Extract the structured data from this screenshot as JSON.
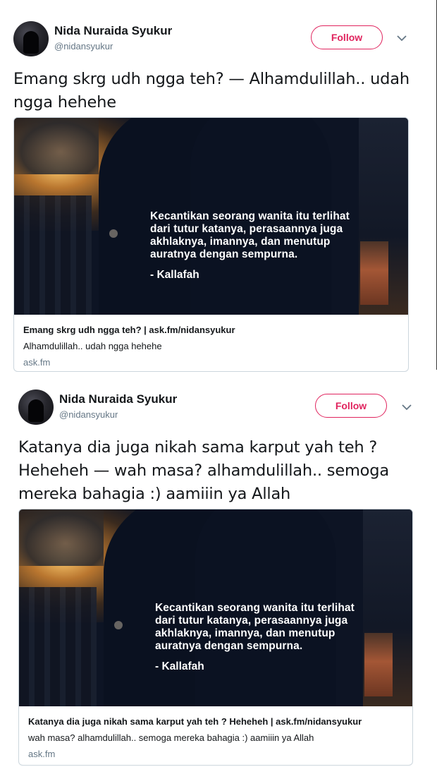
{
  "tweets": [
    {
      "author": {
        "name": "Nida Nuraida Syukur",
        "handle": "@nidansyukur"
      },
      "follow_label": "Follow",
      "text": "Emang skrg udh ngga teh? — Alhamdulillah.. udah ngga hehehe",
      "card": {
        "image_quote": "Kecantikan seorang wanita itu terlihat\ndari tutur katanya, perasaannya juga\nakhlaknya, imannya, dan menutup\nauratnya dengan sempurna.",
        "image_author": "- Kallafah",
        "title": "Emang skrg udh ngga teh? | ask.fm/nidansyukur",
        "description": "Alhamdulillah.. udah ngga hehehe",
        "domain": "ask.fm"
      }
    },
    {
      "author": {
        "name": "Nida Nuraida Syukur",
        "handle": "@nidansyukur"
      },
      "follow_label": "Follow",
      "text": "Katanya dia juga nikah sama karput yah teh ? Heheheh — wah masa? alhamdulillah.. semoga mereka bahagia :) aamiiin ya Allah",
      "card": {
        "image_quote": "Kecantikan seorang wanita itu terlihat\ndari tutur katanya, perasaannya juga\nakhlaknya, imannya, dan menutup\nauratnya dengan sempurna.",
        "image_author": "- Kallafah",
        "title": "Katanya dia juga nikah sama karput yah teh ? Heheheh | ask.fm/nidansyukur",
        "description": "wah masa? alhamdulillah.. semoga mereka bahagia :) aamiiin ya Allah",
        "domain": "ask.fm"
      }
    }
  ],
  "colors": {
    "follow_accent": "#e0245e",
    "secondary_text": "#657786",
    "card_border": "#ccd6dd"
  },
  "icons": {
    "caret": "chevron-down-icon"
  }
}
